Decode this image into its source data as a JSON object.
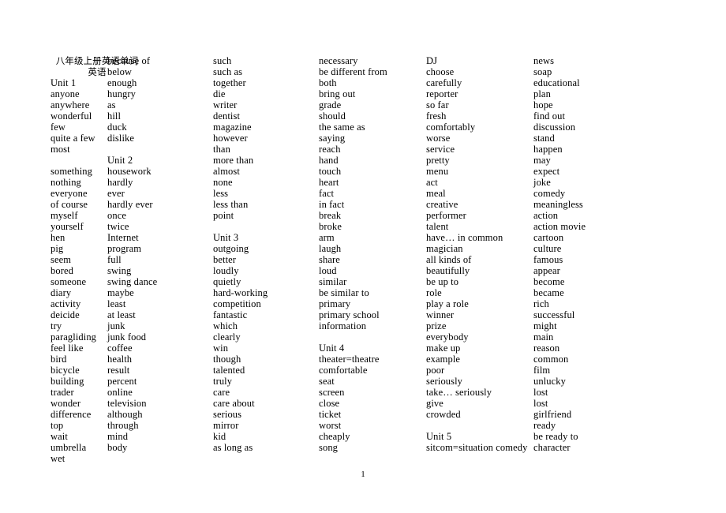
{
  "document": {
    "title_line1": "八年级上册英语单词",
    "title_line2": "英语",
    "page_number": "1",
    "columns": [
      {
        "name": "column-1",
        "entries": [
          "八年级上册英语单词",
          "英语",
          "Unit 1",
          "anyone",
          "anywhere",
          "wonderful",
          "few",
          "quite a few",
          "most",
          "",
          "something",
          "nothing",
          "everyone",
          "of course",
          "myself",
          "yourself",
          "hen",
          "pig",
          "seem",
          "bored",
          "someone",
          "diary",
          "activity",
          "deicide",
          "try",
          "paragliding",
          "feel like",
          "bird",
          "bicycle",
          "building",
          "trader",
          "wonder",
          "difference",
          "top",
          "wait",
          "umbrella",
          "wet"
        ]
      },
      {
        "name": "column-2",
        "entries": [
          "because of",
          "below",
          "enough",
          "hungry",
          "as",
          "hill",
          "duck",
          "dislike",
          "",
          "Unit 2",
          "housework",
          "hardly",
          "ever",
          "hardly ever",
          "once",
          "twice",
          "Internet",
          "program",
          "full",
          "swing",
          "swing dance",
          "maybe",
          "least",
          "at least",
          "junk",
          "junk food",
          "coffee",
          "health",
          "result",
          "percent",
          "online",
          "television",
          "although",
          "through",
          "mind",
          "body"
        ]
      },
      {
        "name": "column-3",
        "entries": [
          "such",
          "such as",
          "together",
          "die",
          "writer",
          "dentist",
          "magazine",
          "however",
          "than",
          "more than",
          "almost",
          "none",
          "less",
          "less than",
          "point",
          "",
          "Unit 3",
          "outgoing",
          "better",
          "loudly",
          "quietly",
          "hard-working",
          "competition",
          "fantastic",
          "which",
          "clearly",
          "win",
          "though",
          "talented",
          "truly",
          "care",
          "care about",
          "serious",
          "mirror",
          "kid",
          "as long as"
        ]
      },
      {
        "name": "column-4",
        "entries": [
          "necessary",
          "be different from",
          "both",
          "bring out",
          "grade",
          "should",
          "the same as",
          "saying",
          "reach",
          "hand",
          "touch",
          "heart",
          "fact",
          "in fact",
          "break",
          "broke",
          "arm",
          "laugh",
          "share",
          "loud",
          "similar",
          "be similar to",
          "primary",
          "primary school",
          "information",
          "",
          "Unit 4",
          "theater=theatre",
          "comfortable",
          "seat",
          "screen",
          "close",
          "ticket",
          "worst",
          "cheaply",
          "song"
        ]
      },
      {
        "name": "column-5",
        "entries": [
          "DJ",
          "choose",
          "carefully",
          "reporter",
          "so far",
          "fresh",
          "comfortably",
          "worse",
          "service",
          "pretty",
          "menu",
          "act",
          "meal",
          "creative",
          "performer",
          "talent",
          "have… in common",
          "magician",
          "all kinds of",
          "beautifully",
          "be up to",
          "role",
          "play a role",
          "winner",
          "prize",
          "everybody",
          "make up",
          "example",
          "poor",
          "seriously",
          "take… seriously",
          "give",
          "crowded",
          "",
          "Unit 5",
          "sitcom=situation comedy"
        ]
      },
      {
        "name": "column-6",
        "entries": [
          "news",
          "soap",
          "educational",
          "plan",
          "hope",
          "find out",
          "discussion",
          "stand",
          "happen",
          "may",
          "expect",
          "joke",
          "comedy",
          "meaningless",
          "action",
          "action movie",
          "cartoon",
          "culture",
          "famous",
          "appear",
          "become",
          "became",
          "rich",
          "successful",
          "might",
          "main",
          "reason",
          "common",
          "film",
          "unlucky",
          "lost",
          "lost",
          "girlfriend",
          "ready",
          "be ready to",
          "character"
        ]
      }
    ]
  }
}
